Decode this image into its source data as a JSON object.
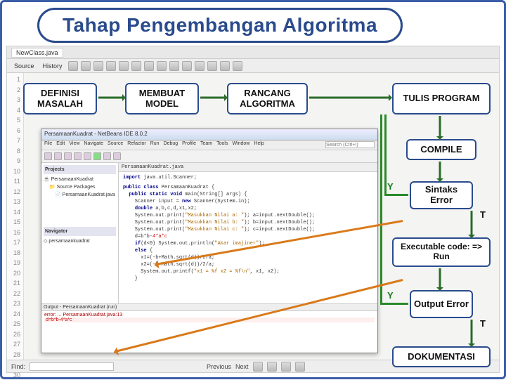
{
  "title": "Tahap Pengembangan Algoritma",
  "ide": {
    "tab": "NewClass.java",
    "sub1": "Source",
    "sub2": "History",
    "find": "Find:",
    "prev": "Previous",
    "next": "Next"
  },
  "flow": {
    "b1": "DEFINISI MASALAH",
    "b2": "MEMBUAT MODEL",
    "b3": "RANCANG ALGORITMA",
    "b4": "TULIS PROGRAM",
    "b5": "COMPILE",
    "b6": "Sintaks Error",
    "b7": "Executable code: => Run",
    "b8": "Output Error",
    "b9": "DOKUMENTASI",
    "y": "Y",
    "t": "T"
  },
  "nb": {
    "title": "PersamaanKuadrat - NetBeans IDE 8.0.2",
    "menu": [
      "File",
      "Edit",
      "View",
      "Navigate",
      "Source",
      "Refactor",
      "Run",
      "Debug",
      "Profile",
      "Team",
      "Tools",
      "Window",
      "Help"
    ],
    "search_ph": "Search (Ctrl+I)",
    "tree_hdr1": "Projects",
    "tree_hdr2": "Navigator",
    "proj": "PersamaanKuadrat",
    "pkg": "Source Packages",
    "cls": "PersamaanKuadrat.java",
    "nav_item": "persamaankuadrat",
    "editor_tab": "PersamaanKuadrat.java",
    "code_l1": "import java.util.Scanner;",
    "code_l2": "public class PersamaanKuadrat {",
    "code_l3": "  public static void main(String[] args) {",
    "code_l4": "    Scanner input = new Scanner(System.in);",
    "code_l5": "    double a,b,c,d,x1,x2;",
    "code_l6": "    System.out.print(\"Masukkan Nilai a: \"); a=input.nextDouble();",
    "code_l7": "    System.out.print(\"Masukkan Nilai b: \"); b=input.nextDouble();",
    "code_l8": "    System.out.print(\"Masukkan Nilai c: \"); c=input.nextDouble();",
    "code_l9": "    d=b*b-4*a*c;",
    "code_l10": "    if(d<0) System.out.println(\"Akar imajiner\");",
    "code_l11": "    else {",
    "code_l12": "      x1=(-b+Math.sqrt(d))/2/a;",
    "code_l13": "      x2=(-b-Math.sqrt(d))/2/a;",
    "code_l14": "      System.out.printf(\"x1 = %f x2 = %f\\n\", x1, x2);",
    "code_l15": "    }",
    "output_hdr": "Output - PersamaanKuadrat (run)",
    "output_err": "error:",
    "output_line": "d=b*b-4*a*c"
  }
}
